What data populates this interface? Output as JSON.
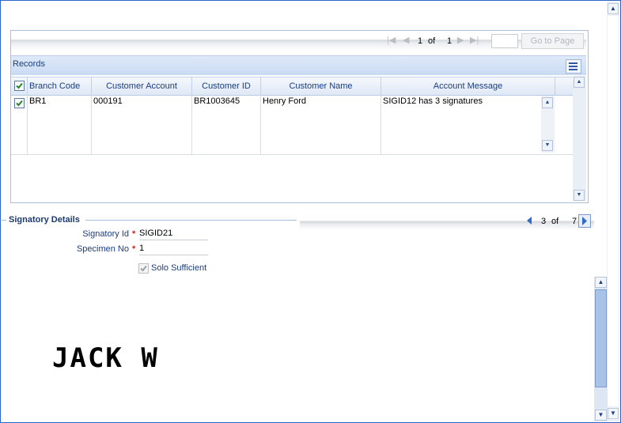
{
  "pager": {
    "current": "1",
    "of_label": "of",
    "total": "1",
    "goto_label": "Go to Page"
  },
  "records": {
    "title": "Records",
    "columns": [
      "Branch Code",
      "Customer Account",
      "Customer ID",
      "Customer Name",
      "Account Message"
    ],
    "rows": [
      {
        "branch_code": "BR1",
        "customer_account": "000191",
        "customer_id": "BR1003645",
        "customer_name": "Henry Ford",
        "account_message": "SIGID12 has 3 signatures",
        "checked": true
      }
    ]
  },
  "signatory": {
    "title": "Signatory Details",
    "signatory_id_label": "Signatory Id",
    "signatory_id_value": "SIGID21",
    "specimen_no_label": "Specimen No",
    "specimen_no_value": "1",
    "solo_sufficient_label": "Solo Sufficient",
    "solo_sufficient_checked": true,
    "required_mark": "*",
    "pager": {
      "current": "3",
      "of_label": "of",
      "total": "7"
    },
    "signature_image_text": "JACK W"
  },
  "icons": {
    "first": "first-page-icon",
    "prev": "prev-page-icon",
    "next": "next-page-icon",
    "last": "last-page-icon",
    "grid": "column-settings-icon"
  },
  "colors": {
    "accent": "#1a3d80",
    "required": "#d0201b",
    "border": "#a9bfd9"
  }
}
